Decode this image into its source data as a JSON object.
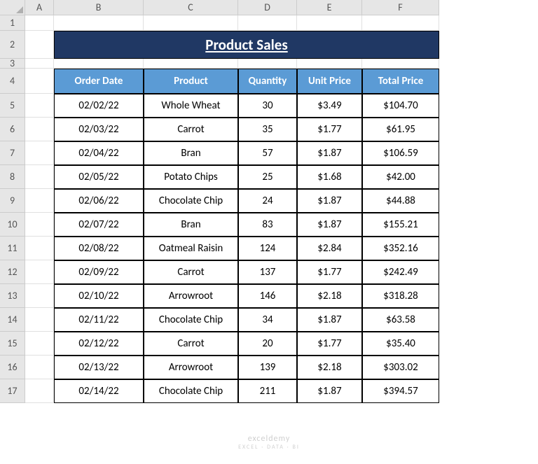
{
  "columns": [
    "A",
    "B",
    "C",
    "D",
    "E",
    "F"
  ],
  "row_numbers": [
    "1",
    "2",
    "3",
    "4",
    "5",
    "6",
    "7",
    "8",
    "9",
    "10",
    "11",
    "12",
    "13",
    "14",
    "15",
    "16",
    "17"
  ],
  "title": "Product Sales",
  "headers": {
    "order_date": "Order Date",
    "product": "Product",
    "quantity": "Quantity",
    "unit_price": "Unit Price",
    "total_price": "Total Price"
  },
  "rows": [
    {
      "date": "02/02/22",
      "product": "Whole Wheat",
      "qty": "30",
      "unit": "$3.49",
      "total": "$104.70"
    },
    {
      "date": "02/03/22",
      "product": "Carrot",
      "qty": "35",
      "unit": "$1.77",
      "total": "$61.95"
    },
    {
      "date": "02/04/22",
      "product": "Bran",
      "qty": "57",
      "unit": "$1.87",
      "total": "$106.59"
    },
    {
      "date": "02/05/22",
      "product": "Potato Chips",
      "qty": "25",
      "unit": "$1.68",
      "total": "$42.00"
    },
    {
      "date": "02/06/22",
      "product": "Chocolate Chip",
      "qty": "24",
      "unit": "$1.87",
      "total": "$44.88"
    },
    {
      "date": "02/07/22",
      "product": "Bran",
      "qty": "83",
      "unit": "$1.87",
      "total": "$155.21"
    },
    {
      "date": "02/08/22",
      "product": "Oatmeal Raisin",
      "qty": "124",
      "unit": "$2.84",
      "total": "$352.16"
    },
    {
      "date": "02/09/22",
      "product": "Carrot",
      "qty": "137",
      "unit": "$1.77",
      "total": "$242.49"
    },
    {
      "date": "02/10/22",
      "product": "Arrowroot",
      "qty": "146",
      "unit": "$2.18",
      "total": "$318.28"
    },
    {
      "date": "02/11/22",
      "product": "Chocolate Chip",
      "qty": "34",
      "unit": "$1.87",
      "total": "$63.58"
    },
    {
      "date": "02/12/22",
      "product": "Carrot",
      "qty": "20",
      "unit": "$1.77",
      "total": "$35.40"
    },
    {
      "date": "02/13/22",
      "product": "Arrowroot",
      "qty": "139",
      "unit": "$2.18",
      "total": "$303.02"
    },
    {
      "date": "02/14/22",
      "product": "Chocolate Chip",
      "qty": "211",
      "unit": "$1.87",
      "total": "$394.57"
    }
  ],
  "watermark": {
    "main": "exceldemy",
    "sub": "EXCEL · DATA · BI"
  }
}
